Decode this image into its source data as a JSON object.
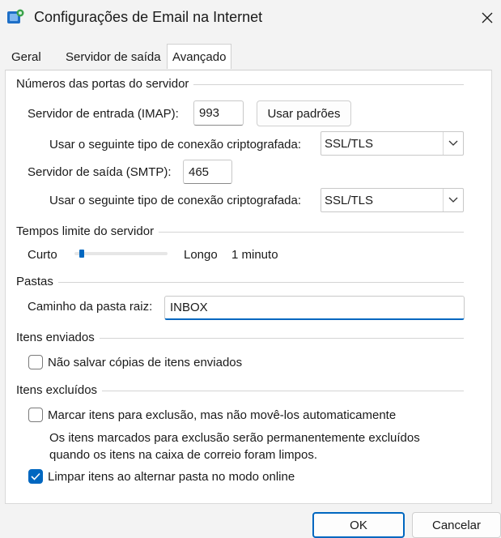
{
  "window": {
    "title": "Configurações de Email na Internet",
    "icon": "outlook-settings-icon",
    "close_icon": "close-icon"
  },
  "tabs": [
    {
      "label": "Geral",
      "active": false
    },
    {
      "label": "Servidor de saída",
      "active": false
    },
    {
      "label": "Avançado",
      "active": true
    }
  ],
  "ports": {
    "group_title": "Números das portas do servidor",
    "incoming_label": "Servidor de entrada (IMAP):",
    "incoming_value": "993",
    "use_defaults": "Usar padrões",
    "incoming_encryption_label": "Usar o seguinte tipo de conexão criptografada:",
    "incoming_encryption_value": "SSL/TLS",
    "outgoing_label": "Servidor de saída (SMTP):",
    "outgoing_value": "465",
    "outgoing_encryption_label": "Usar o seguinte tipo de conexão criptografada:",
    "outgoing_encryption_value": "SSL/TLS"
  },
  "timeouts": {
    "group_title": "Tempos limite do servidor",
    "short_label": "Curto",
    "long_label": "Longo",
    "value_label": "1 minuto",
    "slider_fraction": 0.08
  },
  "folders": {
    "group_title": "Pastas",
    "root_label": "Caminho da pasta raiz:",
    "root_value": "INBOX"
  },
  "sent": {
    "group_title": "Itens enviados",
    "dont_save_label": "Não salvar cópias de itens enviados",
    "dont_save_checked": false
  },
  "deleted": {
    "group_title": "Itens excluídos",
    "mark_label": "Marcar itens para exclusão, mas não movê-los automaticamente",
    "mark_checked": false,
    "info_line1": "Os itens marcados para exclusão serão permanentemente excluídos",
    "info_line2": "quando os itens na caixa de correio foram limpos.",
    "purge_label": "Limpar itens ao alternar pasta no modo online",
    "purge_checked": true
  },
  "buttons": {
    "ok": "OK",
    "cancel": "Cancelar"
  },
  "colors": {
    "accent": "#0067c0"
  }
}
